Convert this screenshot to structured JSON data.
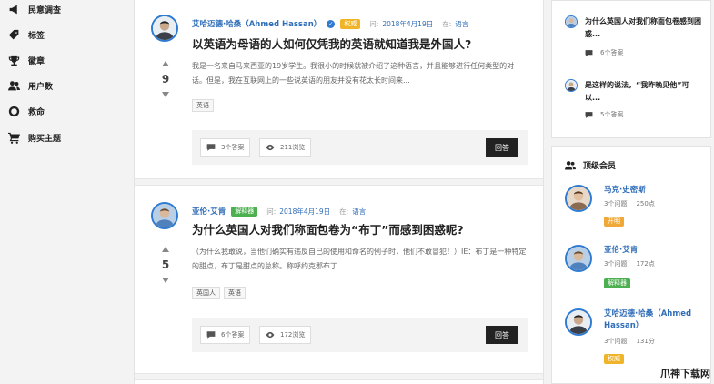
{
  "sidebar": {
    "items": [
      {
        "label": "民意调查",
        "icon": "megaphone-icon"
      },
      {
        "label": "标签",
        "icon": "tags-icon"
      },
      {
        "label": "徽章",
        "icon": "trophy-icon"
      },
      {
        "label": "用户数",
        "icon": "users-icon"
      },
      {
        "label": "救命",
        "icon": "lifebuoy-icon"
      },
      {
        "label": "购买主题",
        "icon": "cart-icon"
      }
    ]
  },
  "feed": {
    "questions": [
      {
        "author": "艾哈迈德·哈桑（Ahmed Hassan）",
        "badge": "权威",
        "asked_label": "问:",
        "date": "2018年4月19日",
        "in_label": "在:",
        "category": "语言",
        "title": "以英语为母语的人如何仅凭我的英语就知道我是外国人?",
        "excerpt": "我是一名来自马来西亚的19岁学生。我很小的时候就被介绍了这种语言，并且能够进行任何类型的对话。但是，我在互联网上的一些说英语的朋友并没有花太长时间来...",
        "votes": "9",
        "tags": [
          "英语"
        ],
        "answers": "3个答案",
        "views": "211浏览",
        "answer_button": "回答"
      },
      {
        "author": "亚伦·艾肯",
        "badge": "解释器",
        "asked_label": "问:",
        "date": "2018年4月19日",
        "in_label": "在:",
        "category": "语言",
        "title": "为什么英国人对我们称面包卷为“布丁”而感到困惑呢?",
        "excerpt": "（为什么我敢说，当他们确实有违反自己的使用和命名的例子时，他们不敢冒犯！）IE：布丁是一种特定的甜点，布丁是甜点的总称。称呼约克郡布丁...",
        "votes": "5",
        "tags": [
          "英国人",
          "英语"
        ],
        "answers": "6个答案",
        "views": "172浏览",
        "answer_button": "回答"
      }
    ]
  },
  "right": {
    "recent_questions": [
      {
        "text": "为什么英国人对我们称面包卷感到困惑...",
        "answers": "6个答案"
      },
      {
        "text": "是这样的说法，“我昨晚见他”可以...",
        "answers": "5个答案"
      }
    ],
    "top_members_title": "顶级会员",
    "members": [
      {
        "name": "马克·史密斯",
        "questions": "3个问题",
        "points": "250点",
        "badge": "开明"
      },
      {
        "name": "亚伦·艾肯",
        "questions": "3个问题",
        "points": "172点",
        "badge": "解释器"
      },
      {
        "name": "艾哈迈德·哈桑（Ahmed Hassan）",
        "questions": "3个问题",
        "points": "131分",
        "badge": "权威"
      }
    ]
  },
  "watermark": "爪神下载网"
}
